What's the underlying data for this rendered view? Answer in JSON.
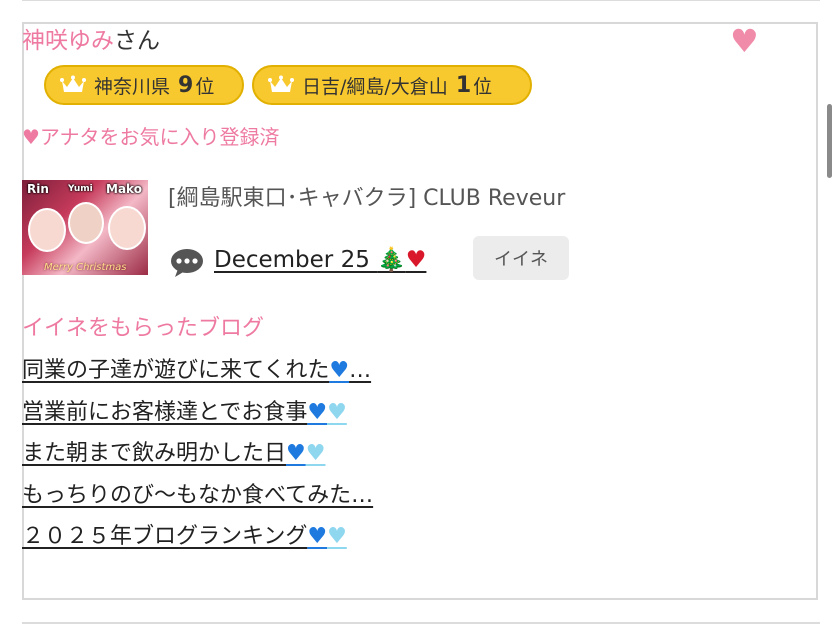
{
  "profile": {
    "name": "神咲ゆみ",
    "honorific": "さん",
    "favorite_heart": "♥",
    "favorite_status": "♥アナタをお気に入り登録済"
  },
  "rankings": [
    {
      "area": "神奈川県",
      "rank": "9",
      "suffix": "位"
    },
    {
      "area": "日吉/綱島/大倉山",
      "rank": "1",
      "suffix": "位"
    }
  ],
  "thumbnail": {
    "labels": [
      "Rin",
      "Yumi",
      "Mako"
    ],
    "caption": "Merry Christmas"
  },
  "shop": {
    "name": "[綱島駅東口･キャバクラ]  CLUB Reveur"
  },
  "message": {
    "text": "December 25 ",
    "tree": "🎄",
    "heart": "♥",
    "iine_label": "イイネ"
  },
  "blog": {
    "heading": "イイネをもらったブログ",
    "posts": [
      {
        "title": "同業の子達が遊びに来てくれた",
        "hearts": [
          "blue"
        ],
        "ellipsis": "…"
      },
      {
        "title": "営業前にお客様達とでお食事",
        "hearts": [
          "blue",
          "light"
        ],
        "ellipsis": ""
      },
      {
        "title": "また朝まで飲み明かした日",
        "hearts": [
          "blue",
          "light"
        ],
        "ellipsis": ""
      },
      {
        "title": "もっちりのび〜もなか食べてみた…",
        "hearts": [],
        "ellipsis": ""
      },
      {
        "title": "２０２５年ブログランキング",
        "hearts": [
          "blue",
          "light"
        ],
        "ellipsis": ""
      }
    ]
  },
  "colors": {
    "accent_pink": "#ee7aa1",
    "badge_gold": "#f8c92e",
    "heart_blue": "#1f7ae0",
    "heart_light_blue": "#8fd6ef"
  }
}
